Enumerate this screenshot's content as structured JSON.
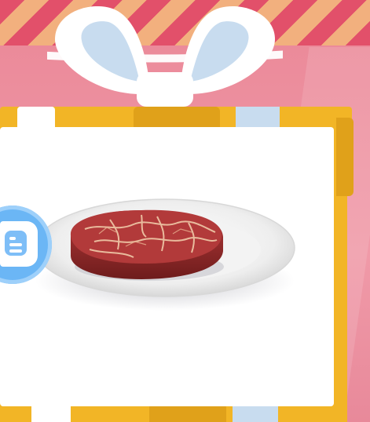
{
  "scene": {
    "item_name": "steak-on-plate",
    "colors": {
      "background": "#e98a98",
      "stripe_red": "#e2506a",
      "stripe_peach": "#f2b07e",
      "gift_gold": "#f2b526",
      "gift_gold_dark": "#e0a11a",
      "ribbon_white": "#ffffff",
      "ribbon_blue": "#c8dcef",
      "card_white": "#ffffff",
      "button_blue": "#6bb6f5"
    },
    "icons": {
      "menu": "list-icon",
      "bow": "gift-bow-icon",
      "item": "steak-icon"
    }
  }
}
